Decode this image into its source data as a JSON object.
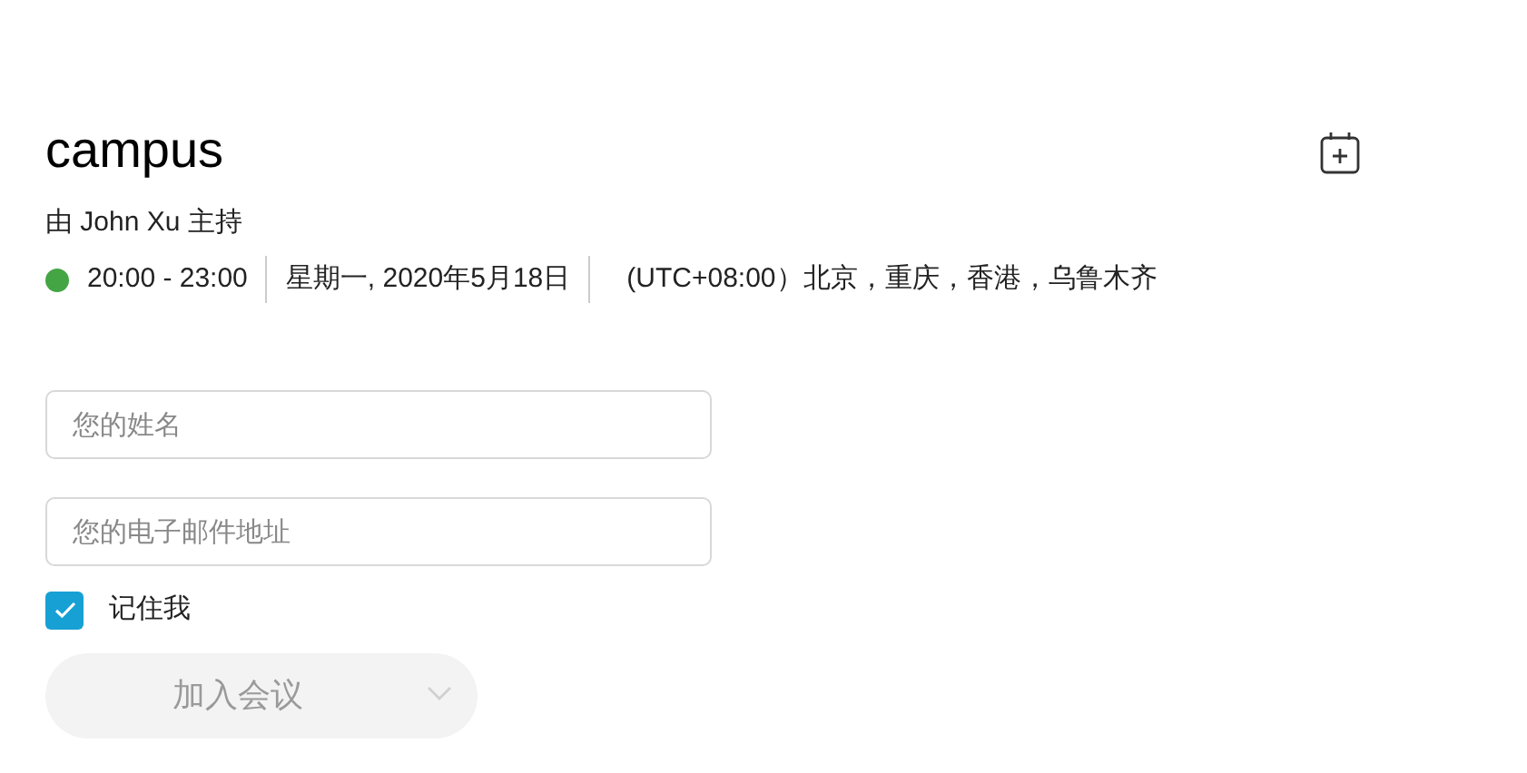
{
  "meeting": {
    "title": "campus",
    "host": "由 John Xu 主持",
    "time": "20:00 - 23:00",
    "date": "星期一, 2020年5月18日",
    "timezone": "(UTC+08:00）北京，重庆，香港，乌鲁木齐"
  },
  "form": {
    "name_field": {
      "placeholder": "您的姓名"
    },
    "email_field": {
      "placeholder": "您的电子邮件地址"
    },
    "remember": {
      "label": "记住我",
      "checked": true
    },
    "join_button": {
      "label": "加入会议",
      "disabled": true
    }
  }
}
